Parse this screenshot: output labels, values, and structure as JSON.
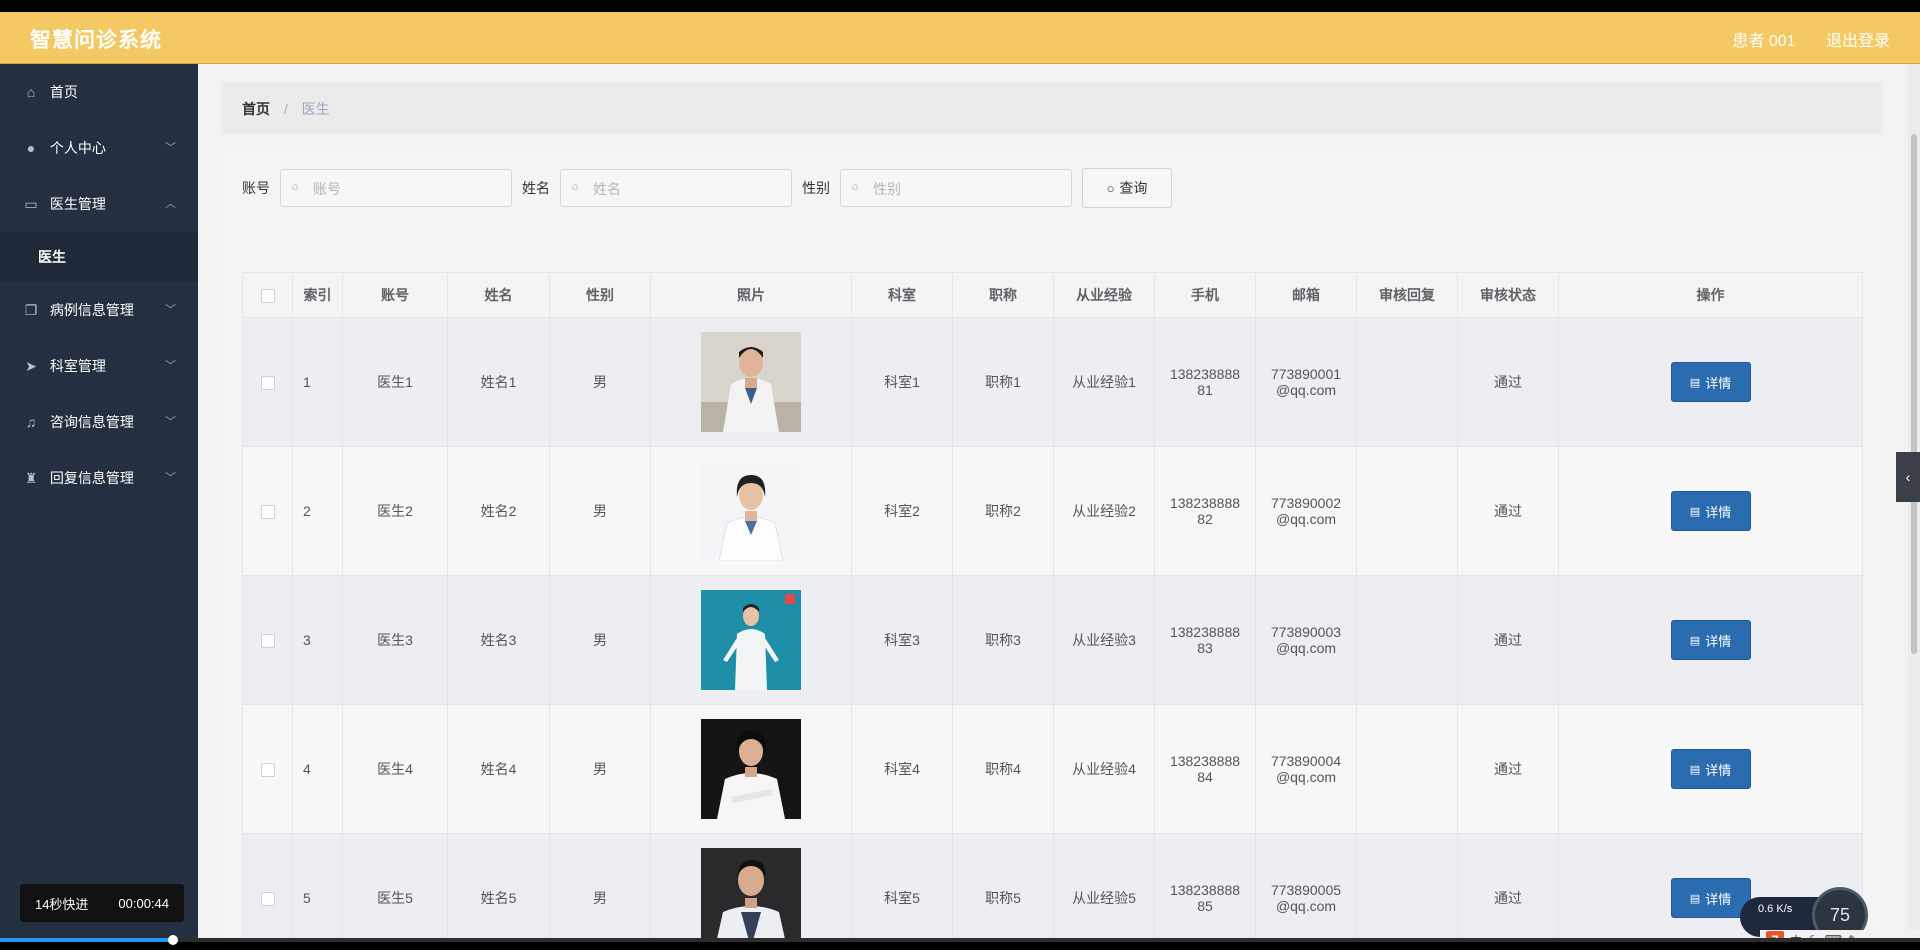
{
  "app": {
    "title": "智慧问诊系统",
    "user": "患者 001",
    "logout": "退出登录"
  },
  "sidebar": {
    "items": [
      {
        "label": "首页",
        "icon": "home-icon",
        "glyph": "⌂",
        "chevron": ""
      },
      {
        "label": "个人中心",
        "icon": "user-icon",
        "glyph": "●",
        "chevron": "﹀"
      },
      {
        "label": "医生管理",
        "icon": "id-card-icon",
        "glyph": "▭",
        "chevron": "︿"
      },
      {
        "label": "病例信息管理",
        "icon": "copy-icon",
        "glyph": "❐",
        "chevron": "﹀"
      },
      {
        "label": "科室管理",
        "icon": "send-icon",
        "glyph": "➤",
        "chevron": "﹀"
      },
      {
        "label": "咨询信息管理",
        "icon": "bell-off-icon",
        "glyph": "♫",
        "chevron": "﹀"
      },
      {
        "label": "回复信息管理",
        "icon": "trophy-icon",
        "glyph": "♜",
        "chevron": "﹀"
      }
    ],
    "sub_item": "医生"
  },
  "breadcrumb": {
    "home": "首页",
    "separator": "/",
    "current": "医生"
  },
  "search": {
    "account_label": "账号",
    "account_placeholder": "账号",
    "name_label": "姓名",
    "name_placeholder": "姓名",
    "gender_label": "性别",
    "gender_placeholder": "性别",
    "query_button": "查询"
  },
  "table": {
    "headers": [
      "",
      "索引",
      "账号",
      "姓名",
      "性别",
      "照片",
      "科室",
      "职称",
      "从业经验",
      "手机",
      "邮箱",
      "审核回复",
      "审核状态",
      "操作"
    ],
    "rows": [
      {
        "index": "1",
        "account": "医生1",
        "name": "姓名1",
        "gender": "男",
        "dept": "科室1",
        "title": "职称1",
        "exp": "从业经验1",
        "phone": "138238888",
        "phone2": "81",
        "email": "773890001",
        "email2": "@qq.com",
        "reply": "",
        "status": "通过",
        "action": "详情"
      },
      {
        "index": "2",
        "account": "医生2",
        "name": "姓名2",
        "gender": "男",
        "dept": "科室2",
        "title": "职称2",
        "exp": "从业经验2",
        "phone": "138238888",
        "phone2": "82",
        "email": "773890002",
        "email2": "@qq.com",
        "reply": "",
        "status": "通过",
        "action": "详情"
      },
      {
        "index": "3",
        "account": "医生3",
        "name": "姓名3",
        "gender": "男",
        "dept": "科室3",
        "title": "职称3",
        "exp": "从业经验3",
        "phone": "138238888",
        "phone2": "83",
        "email": "773890003",
        "email2": "@qq.com",
        "reply": "",
        "status": "通过",
        "action": "详情"
      },
      {
        "index": "4",
        "account": "医生4",
        "name": "姓名4",
        "gender": "男",
        "dept": "科室4",
        "title": "职称4",
        "exp": "从业经验4",
        "phone": "138238888",
        "phone2": "84",
        "email": "773890004",
        "email2": "@qq.com",
        "reply": "",
        "status": "通过",
        "action": "详情"
      },
      {
        "index": "5",
        "account": "医生5",
        "name": "姓名5",
        "gender": "男",
        "dept": "科室5",
        "title": "职称5",
        "exp": "从业经验5",
        "phone": "138238888",
        "phone2": "85",
        "email": "773890005",
        "email2": "@qq.com",
        "reply": "",
        "status": "通过",
        "action": "详情"
      }
    ]
  },
  "video": {
    "speed_label": "14秒快进",
    "time": "00:00:44",
    "progress": 0.09
  },
  "net": {
    "speed": "0.6",
    "unit": "K/s",
    "percent": "75"
  },
  "colors": {
    "header": "#f4c964",
    "sidebar": "#242f3f",
    "button": "#2b6cb0"
  }
}
